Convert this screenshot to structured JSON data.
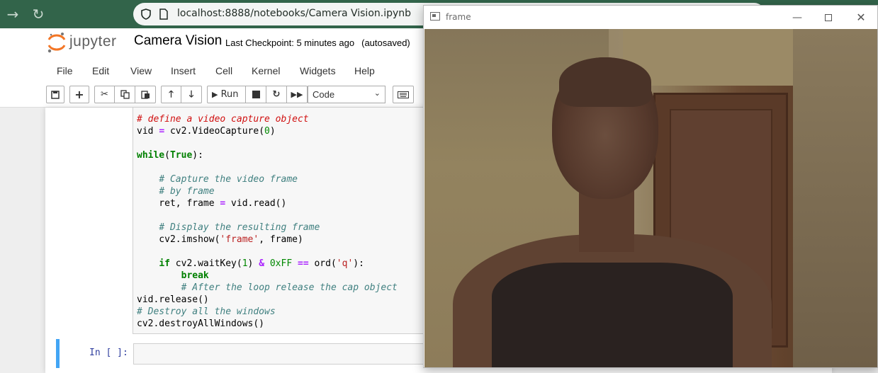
{
  "browser": {
    "url": "localhost:8888/notebooks/Camera Vision.ipynb"
  },
  "jupyter": {
    "logo_text": "jupyter",
    "notebook_title": "Camera Vision",
    "checkpoint": "Last Checkpoint: 5 minutes ago",
    "autosave": "(autosaved)",
    "menu": [
      "File",
      "Edit",
      "View",
      "Insert",
      "Cell",
      "Kernel",
      "Widgets",
      "Help"
    ],
    "toolbar": {
      "run_label": "Run",
      "cell_type": "Code"
    }
  },
  "code_lines": [
    "# define a video capture object",
    "vid = cv2.VideoCapture(0)",
    "",
    "while(True):",
    "",
    "    # Capture the video frame",
    "    # by frame",
    "    ret, frame = vid.read()",
    "",
    "    # Display the resulting frame",
    "    cv2.imshow('frame', frame)",
    "",
    "    if cv2.waitKey(1) & 0xFF == ord('q'):",
    "        break",
    "        # After the loop release the cap object",
    "vid.release()",
    "# Destroy all the windows",
    "cv2.destroyAllWindows()"
  ],
  "empty_cell_prompt": "In [ ]:",
  "frame_window": {
    "title": "frame",
    "icons": [
      "minimize-icon",
      "maximize-icon",
      "close-icon"
    ]
  },
  "colors": {
    "browser_bar": "#32644a",
    "jupyter_orange": "#f37626",
    "cell_active_border": "#42a5f5"
  }
}
